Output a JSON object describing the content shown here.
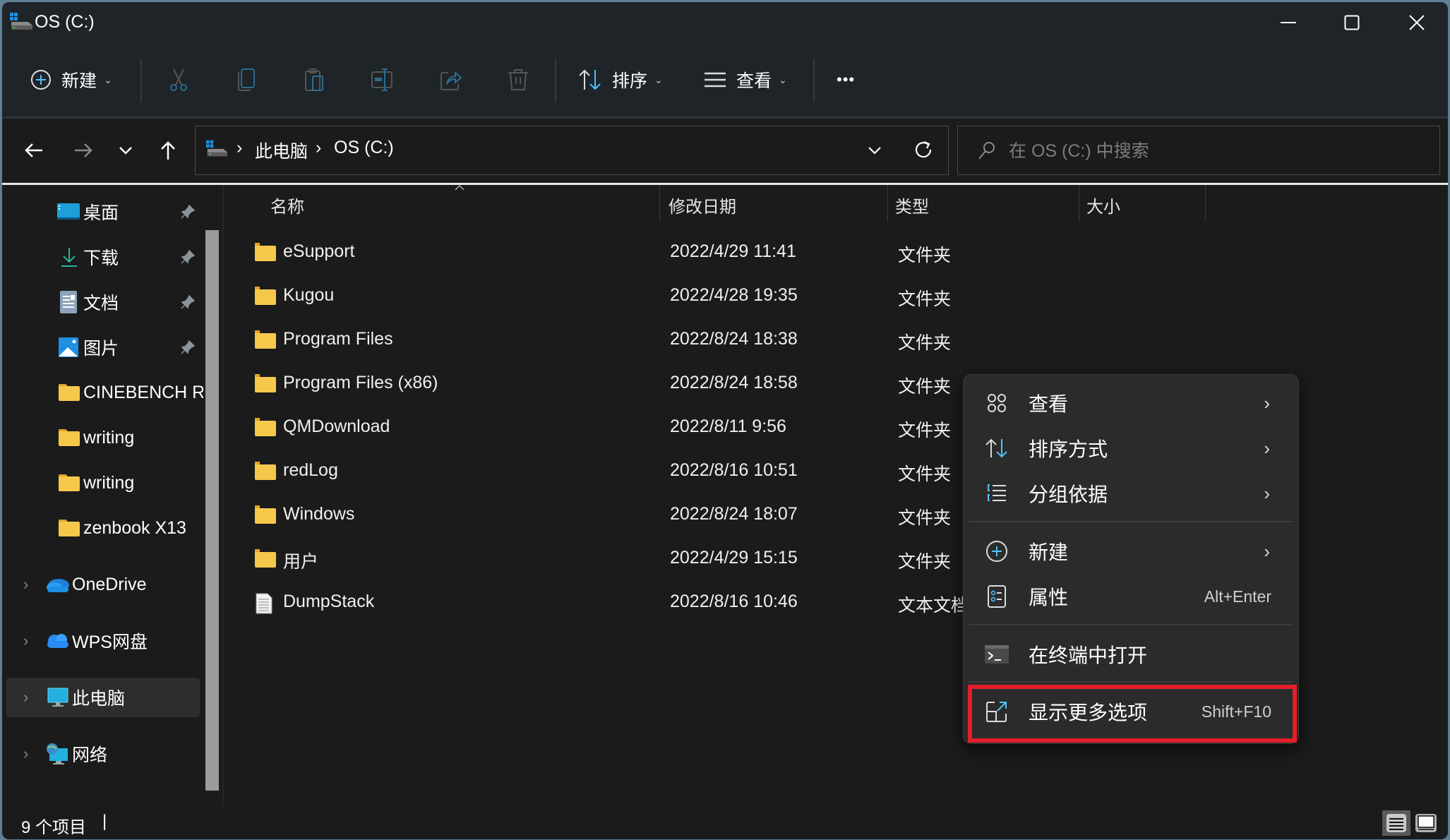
{
  "window": {
    "title": "OS (C:)",
    "icon": "drive-icon"
  },
  "window_controls": {
    "minimize": "minimize-icon",
    "maximize": "maximize-icon",
    "close": "close-icon"
  },
  "toolbar": {
    "new_label": "新建",
    "sort_label": "排序",
    "view_label": "查看",
    "more_label": "•••",
    "icons": [
      "plus-circle-icon",
      "cut-icon",
      "copy-icon",
      "paste-icon",
      "rename-icon",
      "share-icon",
      "delete-icon",
      "sort-icon",
      "view-icon",
      "more-icon"
    ]
  },
  "navigation": {
    "breadcrumb": [
      "此电脑",
      "OS (C:)"
    ],
    "search_placeholder": "在 OS (C:) 中搜索"
  },
  "sidebar": {
    "items": [
      {
        "label": "桌面",
        "icon": "desktop-icon",
        "pinned": true
      },
      {
        "label": "下载",
        "icon": "download-icon",
        "pinned": true
      },
      {
        "label": "文档",
        "icon": "documents-icon",
        "pinned": true
      },
      {
        "label": "图片",
        "icon": "pictures-icon",
        "pinned": true
      },
      {
        "label": "CINEBENCH R",
        "icon": "folder-icon",
        "pinned": false
      },
      {
        "label": "writing",
        "icon": "folder-icon",
        "pinned": false
      },
      {
        "label": "writing",
        "icon": "folder-icon",
        "pinned": false
      },
      {
        "label": "zenbook X13",
        "icon": "folder-icon",
        "pinned": false
      },
      {
        "label": "OneDrive",
        "icon": "onedrive-icon",
        "expandable": true
      },
      {
        "label": "WPS网盘",
        "icon": "wps-cloud-icon",
        "expandable": true
      },
      {
        "label": "此电脑",
        "icon": "this-pc-icon",
        "expandable": true,
        "selected": true
      },
      {
        "label": "网络",
        "icon": "network-icon",
        "expandable": true
      }
    ]
  },
  "file_list": {
    "columns": [
      "名称",
      "修改日期",
      "类型",
      "大小"
    ],
    "rows": [
      {
        "name": "eSupport",
        "date": "2022/4/29 11:41",
        "type": "文件夹",
        "size": "",
        "icon": "folder-icon"
      },
      {
        "name": "Kugou",
        "date": "2022/4/28 19:35",
        "type": "文件夹",
        "size": "",
        "icon": "folder-icon"
      },
      {
        "name": "Program Files",
        "date": "2022/8/24 18:38",
        "type": "文件夹",
        "size": "",
        "icon": "folder-icon"
      },
      {
        "name": "Program Files (x86)",
        "date": "2022/8/24 18:58",
        "type": "文件夹",
        "size": "",
        "icon": "folder-icon"
      },
      {
        "name": "QMDownload",
        "date": "2022/8/11 9:56",
        "type": "文件夹",
        "size": "",
        "icon": "folder-icon"
      },
      {
        "name": "redLog",
        "date": "2022/8/16 10:51",
        "type": "文件夹",
        "size": "",
        "icon": "folder-icon"
      },
      {
        "name": "Windows",
        "date": "2022/8/24 18:07",
        "type": "文件夹",
        "size": "",
        "icon": "folder-icon"
      },
      {
        "name": "用户",
        "date": "2022/4/29 15:15",
        "type": "文件夹",
        "size": "",
        "icon": "folder-icon"
      },
      {
        "name": "DumpStack",
        "date": "2022/8/16 10:46",
        "type": "文本文档",
        "size": "",
        "icon": "text-file-icon"
      }
    ]
  },
  "context_menu": {
    "items": [
      {
        "label": "查看",
        "icon": "grid-view-icon",
        "submenu": true,
        "shortcut": ""
      },
      {
        "label": "排序方式",
        "icon": "sort-icon",
        "submenu": true,
        "shortcut": ""
      },
      {
        "label": "分组依据",
        "icon": "group-by-icon",
        "submenu": true,
        "shortcut": ""
      },
      {
        "label": "新建",
        "icon": "plus-circle-icon",
        "submenu": true,
        "shortcut": ""
      },
      {
        "label": "属性",
        "icon": "properties-icon",
        "submenu": false,
        "shortcut": "Alt+Enter"
      },
      {
        "label": "在终端中打开",
        "icon": "terminal-icon",
        "submenu": false,
        "shortcut": ""
      },
      {
        "label": "显示更多选项",
        "icon": "show-more-icon",
        "submenu": false,
        "shortcut": "Shift+F10",
        "highlighted": true
      }
    ],
    "highlight_color": "#e51f2a"
  },
  "status_bar": {
    "item_count": "9 个项目"
  },
  "colors": {
    "accent": "#4cc2ff",
    "folder": "#f5c84c",
    "titlebar_bg": "#1e2428",
    "content_bg": "#1b1b1b"
  }
}
